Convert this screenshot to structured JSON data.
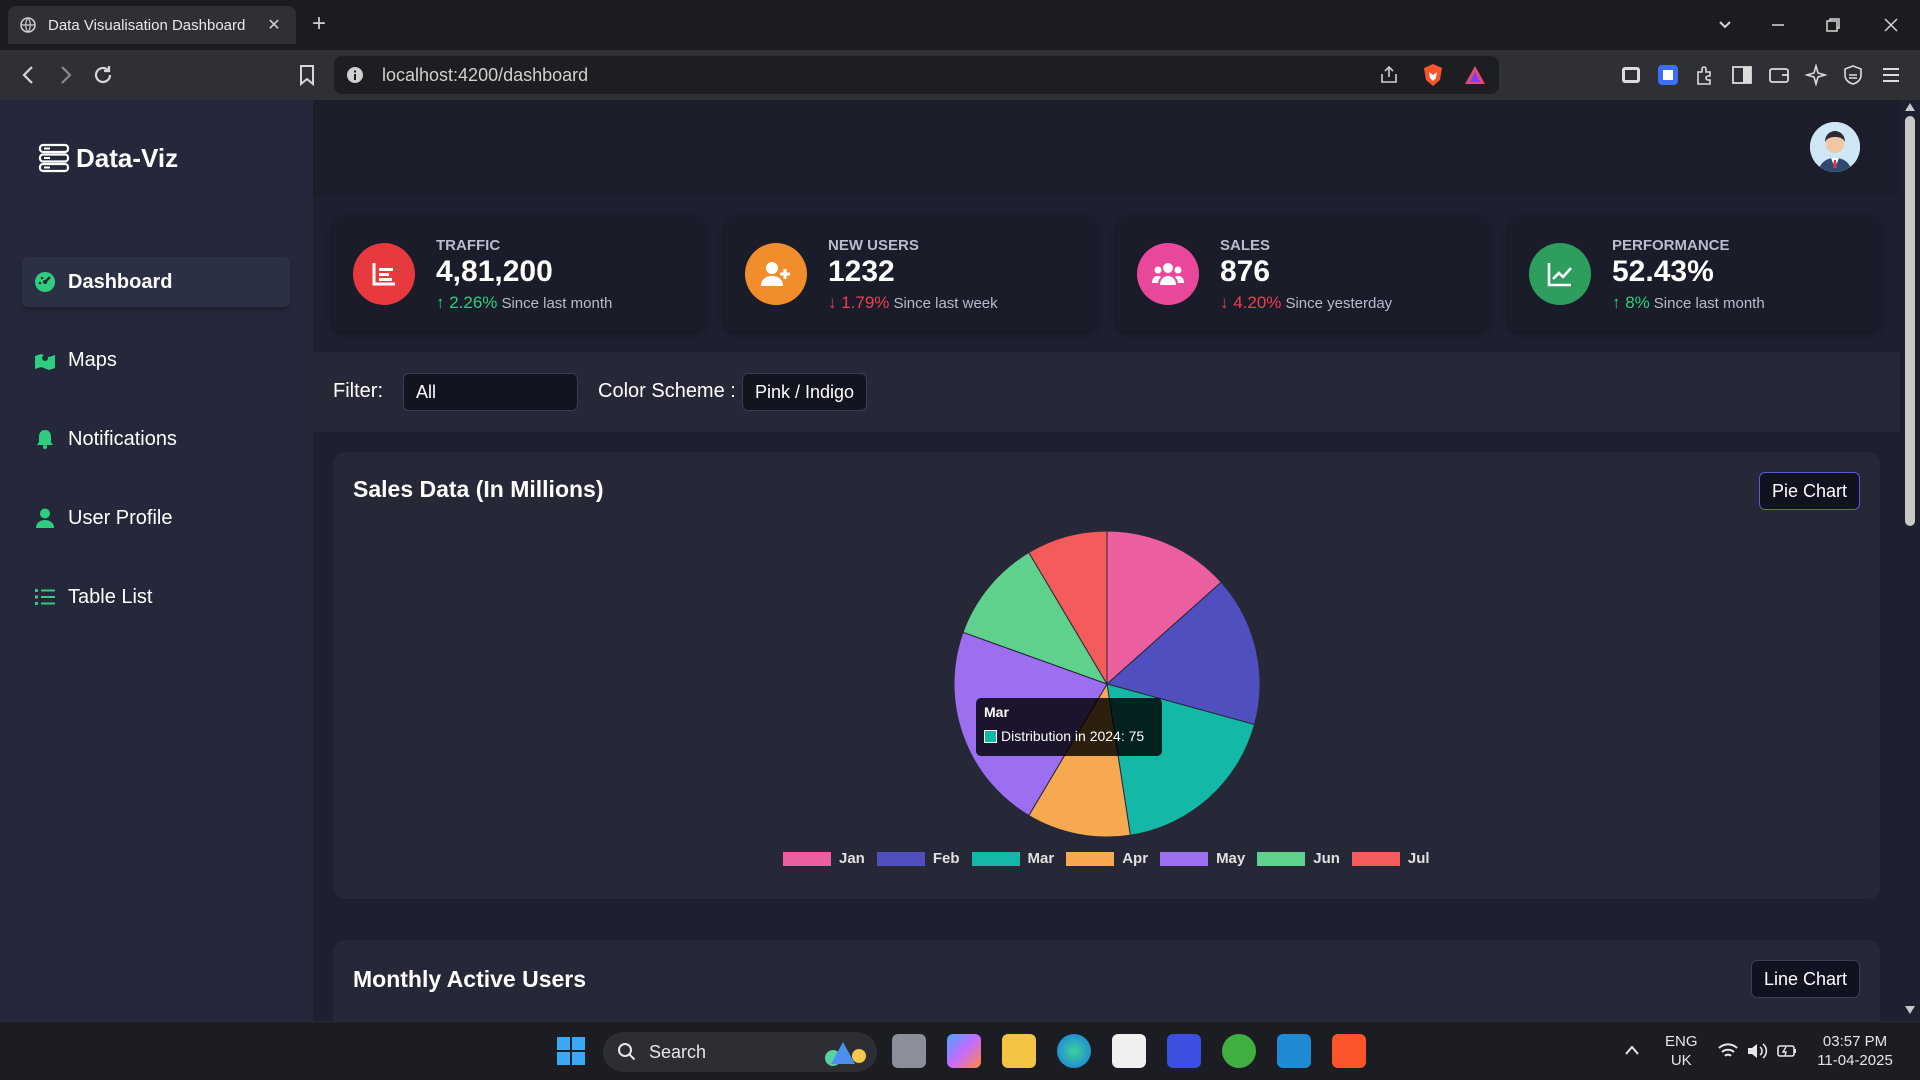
{
  "browser": {
    "tab_title": "Data Visualisation Dashboard",
    "new_tab_symbol": "+",
    "close_symbol": "✕",
    "url": "localhost:4200/dashboard"
  },
  "sidebar": {
    "brand": "Data-Viz",
    "items": [
      {
        "label": "Dashboard",
        "icon": "dashboard-icon",
        "active": true
      },
      {
        "label": "Maps",
        "icon": "map-icon",
        "active": false
      },
      {
        "label": "Notifications",
        "icon": "bell-icon",
        "active": false
      },
      {
        "label": "User Profile",
        "icon": "user-icon",
        "active": false
      },
      {
        "label": "Table List",
        "icon": "list-icon",
        "active": false
      }
    ],
    "accent": "#2fce7e"
  },
  "stats": [
    {
      "label": "TRAFFIC",
      "value": "4,81,200",
      "change": "↑ 2.26%",
      "since": "Since last month",
      "trend": "up",
      "color": "#e8393f",
      "icon": "chart-bar-icon"
    },
    {
      "label": "NEW USERS",
      "value": "1232",
      "change": "↓ 1.79%",
      "since": "Since last week",
      "trend": "down",
      "color": "#f28d2c",
      "icon": "user-plus-icon"
    },
    {
      "label": "SALES",
      "value": "876",
      "change": "↓ 4.20%",
      "since": "Since yesterday",
      "trend": "down",
      "color": "#e9489a",
      "icon": "users-icon"
    },
    {
      "label": "PERFORMANCE",
      "value": "52.43%",
      "change": "↑ 8%",
      "since": "Since last month",
      "trend": "up",
      "color": "#2e9e5f",
      "icon": "trend-up-icon"
    }
  ],
  "filters": {
    "filter_label": "Filter:",
    "filter_value": "All",
    "scheme_label": "Color Scheme :",
    "scheme_value": "Pink / Indigo"
  },
  "sales_card": {
    "title": "Sales Data (In Millions)",
    "chart_type_button": "Pie Chart"
  },
  "users_card": {
    "title": "Monthly Active Users",
    "chart_type_button": "Line Chart"
  },
  "tooltip": {
    "title": "Mar",
    "label": "Distribution in 2024: 75",
    "color": "#14b8a6"
  },
  "chart_data": {
    "type": "pie",
    "title": "Sales Data (In Millions)",
    "categories": [
      "Jan",
      "Feb",
      "Mar",
      "Apr",
      "May",
      "Jun",
      "Jul"
    ],
    "series": [
      {
        "name": "Distribution in 2024",
        "values": [
          55,
          65,
          75,
          45,
          90,
          45,
          35
        ]
      }
    ],
    "legend_position": "bottom",
    "colors": [
      "#ec5f9f",
      "#4f4fc0",
      "#14b8a6",
      "#f6a951",
      "#9b6ff0",
      "#5fd18c",
      "#f45b5b"
    ]
  },
  "taskbar": {
    "search_label": "Search",
    "lang_top": "ENG",
    "lang_bottom": "UK",
    "time": "03:57 PM",
    "date": "11-04-2025"
  }
}
